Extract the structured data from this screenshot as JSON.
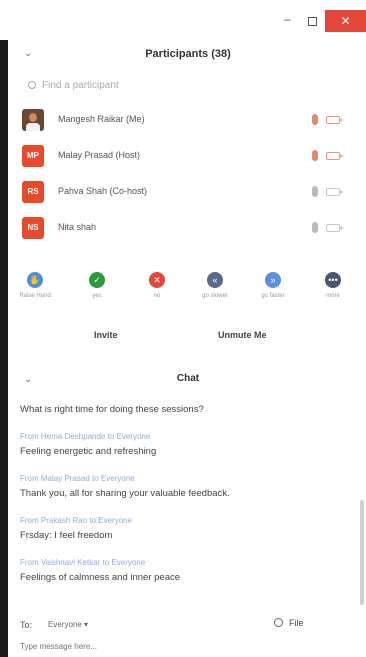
{
  "window": {
    "minimize_glyph": "–",
    "close_glyph": "✕"
  },
  "participants_panel": {
    "title": "Participants (38)",
    "search_placeholder": "Find a participant",
    "participants": [
      {
        "name": "Mangesh Raikar (Me)",
        "initials": "",
        "avatar": "photo",
        "mic_state": "unmuted",
        "video_state": "off"
      },
      {
        "name": "Malay Prasad (Host)",
        "initials": "MP",
        "avatar": "initials",
        "mic_state": "unmuted",
        "video_state": "off"
      },
      {
        "name": "Pahva Shah (Co-host)",
        "initials": "RS",
        "avatar": "initials",
        "mic_state": "muted",
        "video_state": "off"
      },
      {
        "name": "Nita shah",
        "initials": "NS",
        "avatar": "initials",
        "mic_state": "muted",
        "video_state": "off"
      }
    ],
    "reactions": [
      {
        "label": "Raise Hand",
        "glyph": "✋",
        "color": "#4a90e2"
      },
      {
        "label": "yes",
        "glyph": "✓",
        "color": "#2b9a3a"
      },
      {
        "label": "no",
        "glyph": "✕",
        "color": "#e5463a"
      },
      {
        "label": "go slower",
        "glyph": "«",
        "color": "#5a6a8a"
      },
      {
        "label": "go faster",
        "glyph": "»",
        "color": "#5b8fe0"
      },
      {
        "label": "more",
        "glyph": "•••",
        "color": "#4a5572"
      }
    ],
    "invite_label": "Invite",
    "unmute_label": "Unmute Me"
  },
  "chat_panel": {
    "title": "Chat",
    "first_message": "What is right time for doing these sessions?",
    "messages": [
      {
        "from": "From Hema Deshpande to Everyone",
        "text": "Feeling energetic and refreshing"
      },
      {
        "from": "From Malay Prasad to Everyone",
        "text": "Thank you, all for sharing your valuable feedback."
      },
      {
        "from": "From Prakash Rao to Everyone",
        "text": "Frsday: I feel freedom"
      },
      {
        "from": "From Vaishnavi Ketkar to Everyone",
        "text": "Feelings of calmness and inner peace"
      }
    ],
    "to_label": "To:",
    "recipient": "Everyone",
    "file_label": "File",
    "input_placeholder": "Type message here..."
  }
}
